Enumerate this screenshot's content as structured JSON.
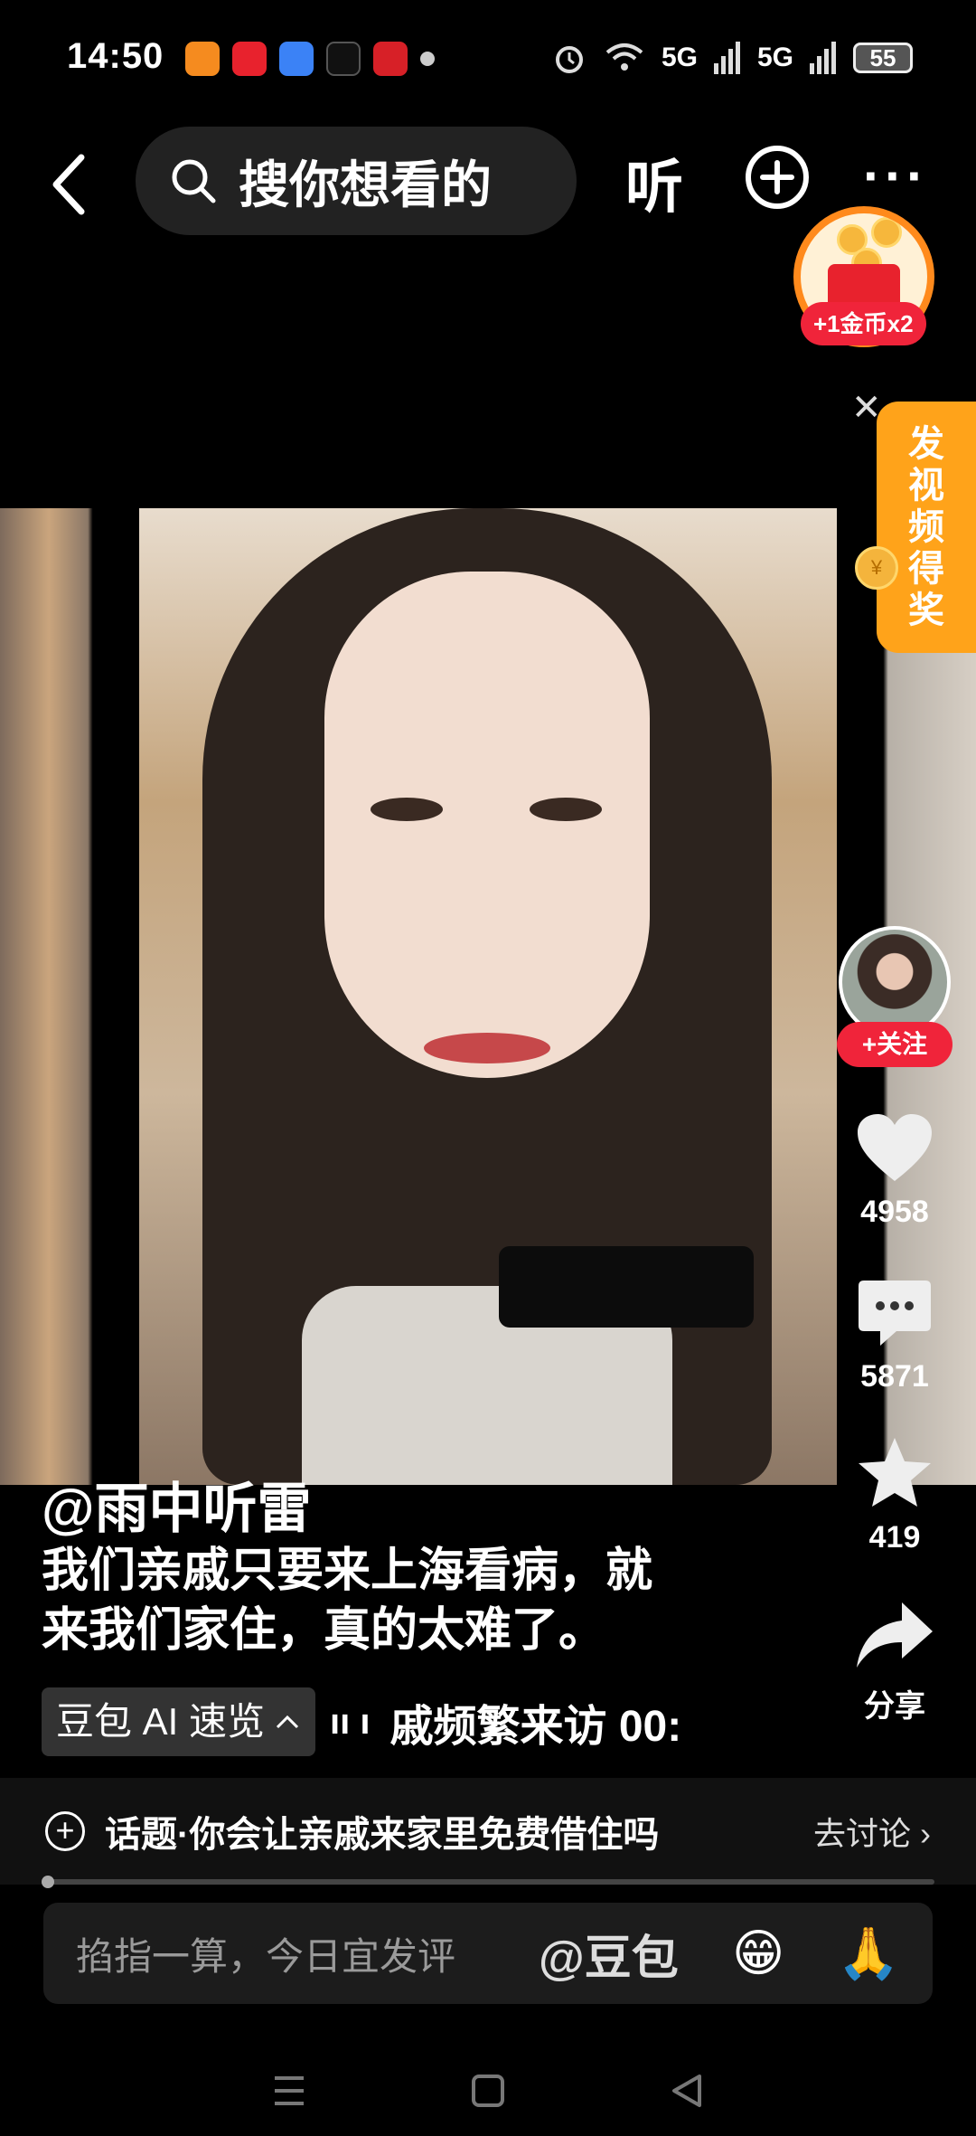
{
  "status_bar": {
    "time": "14:50",
    "network": "5G",
    "battery": "55",
    "app_icon_colors": [
      "#f58b1f",
      "#e8222d",
      "#3b82f6",
      "#111111",
      "#d72027"
    ]
  },
  "top_bar": {
    "search_placeholder": "搜你想看的",
    "listen_label": "听"
  },
  "reward": {
    "badge": "+1金币x2"
  },
  "promo": {
    "chars": [
      "发",
      "视",
      "频",
      "得",
      "奖"
    ],
    "coin_symbol": "¥"
  },
  "side_actions": {
    "follow_label": "+关注",
    "like_count": "4958",
    "comment_count": "5871",
    "favorite_count": "419",
    "share_label": "分享"
  },
  "caption": {
    "author": "@雨中听雷",
    "line1": "我们亲戚只要来上海看病，就",
    "line2": "来我们家住，真的太难了。",
    "ai_chip": "豆包 AI 速览",
    "ai_preview": "戚频繁来访   00:"
  },
  "topic": {
    "text": "话题·你会让亲戚来家里免费借住吗",
    "link": "去讨论"
  },
  "comment_bar": {
    "placeholder": "掐指一算，今日宜发评",
    "mention": "@豆包",
    "emoji_1": "😁",
    "emoji_2": "🙏"
  },
  "colors": {
    "accent_red": "#f0243a",
    "promo_orange": "#ffa31a",
    "coin_ring": "#ff8a1c"
  }
}
